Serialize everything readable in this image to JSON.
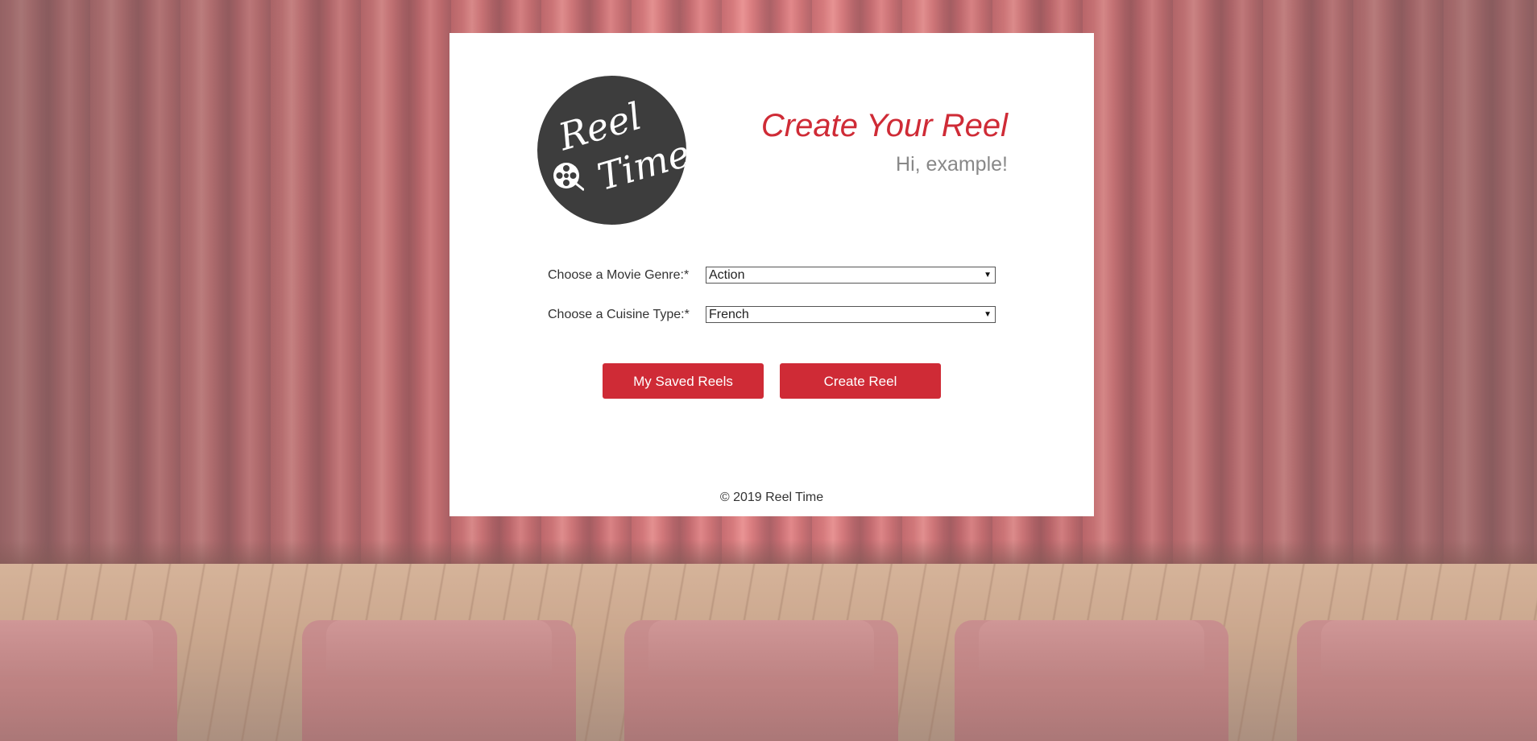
{
  "brand": {
    "logo_line1": "Reel",
    "logo_line2": "Time"
  },
  "header": {
    "title": "Create Your Reel",
    "greeting": "Hi, example!"
  },
  "form": {
    "genre_label": "Choose a Movie Genre:*",
    "genre_value": "Action",
    "cuisine_label": "Choose a Cuisine Type:*",
    "cuisine_value": "French"
  },
  "actions": {
    "saved_label": "My Saved Reels",
    "create_label": "Create Reel"
  },
  "footer": {
    "text": "© 2019 Reel Time"
  },
  "colors": {
    "accent": "#cf2b36",
    "logo_bg": "#3d3d3d",
    "greeting": "#888888"
  },
  "icons": {
    "dropdown": "chevron-down-icon",
    "reel": "film-reel-icon"
  }
}
